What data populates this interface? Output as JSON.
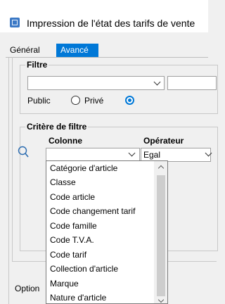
{
  "window": {
    "title": "Impression de l'état des tarifs de vente"
  },
  "tabs": [
    {
      "label": "Général"
    },
    {
      "label": "Avancé",
      "active": true
    }
  ],
  "filtre": {
    "group_label": "Filtre",
    "radios": [
      {
        "label": "Public",
        "selected": false
      },
      {
        "label": "Privé",
        "selected": false
      },
      {
        "label": "",
        "selected": true
      }
    ]
  },
  "critere": {
    "group_label": "Critère de filtre",
    "col_header": "Colonne",
    "op_header": "Opérateur",
    "column_value": "",
    "operator_value": "Egal"
  },
  "dropdown": {
    "items": [
      "Catégorie d'article",
      "Classe",
      "Code article",
      "Code changement tarif",
      "Code famille",
      "Code T.V.A.",
      "Code tarif",
      "Collection d'article",
      "Marque",
      "Nature d'article"
    ]
  },
  "options": {
    "label": "Option"
  },
  "colors": {
    "accent": "#0078d7",
    "icon": "#3b78c5"
  },
  "icons": {
    "app": "report-app-icon",
    "search": "search-icon"
  }
}
